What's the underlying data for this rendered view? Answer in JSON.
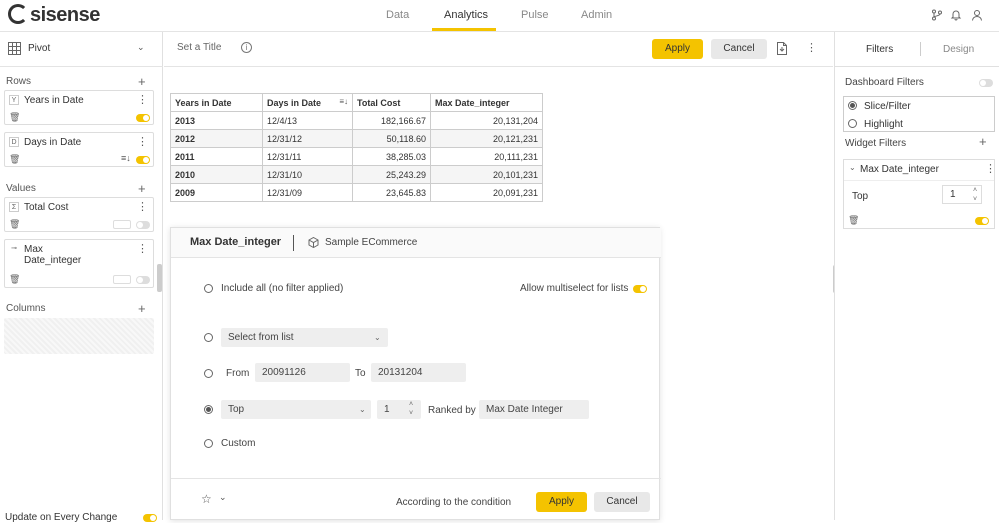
{
  "app": {
    "logo_text": "sisense",
    "nav_tabs": [
      "Data",
      "Analytics",
      "Pulse",
      "Admin"
    ],
    "active_tab": "Analytics",
    "accent_color": "#f4c300"
  },
  "left_panel": {
    "widget_type": "Pivot",
    "rows_title": "Rows",
    "rows": [
      {
        "type_badge": "Y",
        "name": "Years in Date"
      },
      {
        "type_badge": "D",
        "name": "Days in Date"
      }
    ],
    "values_title": "Values",
    "values": [
      {
        "type_badge": "Σ",
        "name": "Total Cost"
      },
      {
        "type_badge": "⊸",
        "name_line1": "Max",
        "name_line2": "Date_integer"
      }
    ],
    "columns_title": "Columns",
    "update_label": "Update on Every Change"
  },
  "center": {
    "title_placeholder": "Set a Title",
    "apply_label": "Apply",
    "cancel_label": "Cancel",
    "table": {
      "headers": [
        "Years in Date",
        "Days in Date",
        "Total Cost",
        "Max Date_integer"
      ],
      "rows": [
        [
          "2013",
          "12/4/13",
          "182,166.67",
          "20,131,204"
        ],
        [
          "2012",
          "12/31/12",
          "50,118.60",
          "20,121,231"
        ],
        [
          "2011",
          "12/31/11",
          "38,285.03",
          "20,111,231"
        ],
        [
          "2010",
          "12/31/10",
          "25,243.29",
          "20,101,231"
        ],
        [
          "2009",
          "12/31/09",
          "23,645.83",
          "20,091,231"
        ]
      ]
    }
  },
  "filter_dialog": {
    "field_name": "Max Date_integer",
    "datasource": "Sample ECommerce",
    "include_all_label": "Include all (no filter applied)",
    "allow_multiselect_label": "Allow multiselect for lists",
    "select_from_list_placeholder": "Select from list",
    "from_label": "From",
    "from_value": "20091126",
    "to_label": "To",
    "to_value": "20131204",
    "top_mode": "Top",
    "top_count": "1",
    "ranked_by_label": "Ranked by",
    "ranked_by_value": "Max Date Integer",
    "custom_label": "Custom",
    "selected_option": "top",
    "condition_text": "According to the condition",
    "apply_label": "Apply",
    "cancel_label": "Cancel"
  },
  "right_panel": {
    "tabs": [
      "Filters",
      "Design"
    ],
    "active_tab": "Filters",
    "dashboard_filters_label": "Dashboard Filters",
    "filter_options": [
      "Slice/Filter",
      "Highlight"
    ],
    "selected_filter_option": "Slice/Filter",
    "widget_filters_label": "Widget Filters",
    "widget_filter": {
      "name": "Max Date_integer",
      "mode": "Top",
      "count": "1"
    }
  }
}
